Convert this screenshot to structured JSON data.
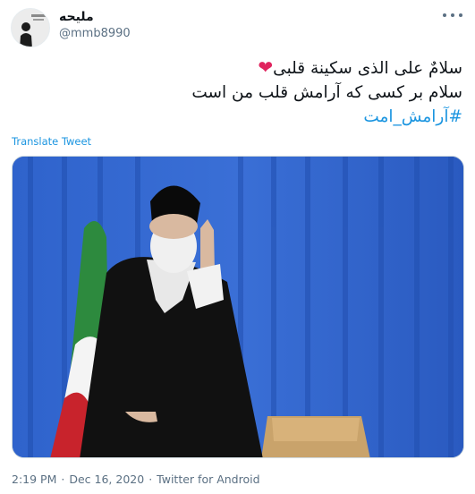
{
  "author": {
    "display_name": "ملیحه",
    "handle": "@mmb8990",
    "avatar_icon": "profile-photo"
  },
  "menu_icon": "more-horizontal-icon",
  "tweet": {
    "line1": "سلامٌ علی الذی سکینة قلبی",
    "heart": "❤",
    "line2": "سلام بر کسی که آرامش قلب من است",
    "hashtag": "#آرامش_امت"
  },
  "translate_label": "Translate Tweet",
  "media": {
    "icon": "photo-attachment"
  },
  "meta": {
    "time": "2:19 PM",
    "separator": "·",
    "date": "Dec 16, 2020",
    "separator2": "·",
    "source": "Twitter for Android"
  },
  "colors": {
    "link": "#1b95e0",
    "secondary_text": "#5b7083",
    "heart": "#e0245e",
    "curtain": "#2b5bc4"
  }
}
